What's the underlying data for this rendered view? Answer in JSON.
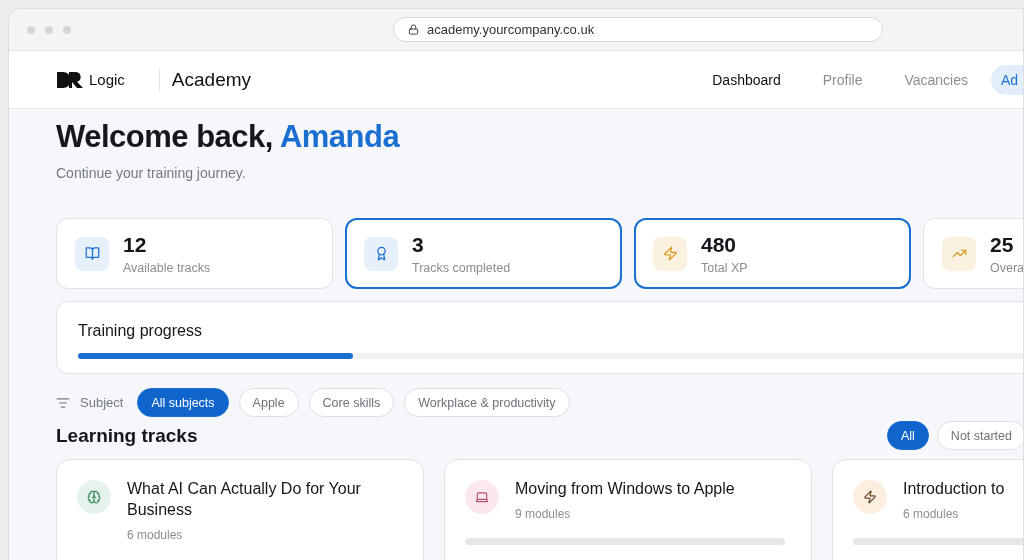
{
  "browser": {
    "url": "academy.yourcompany.co.uk"
  },
  "header": {
    "logo": "Logic",
    "section": "Academy",
    "nav": [
      {
        "label": "Dashboard",
        "kind": "primary"
      },
      {
        "label": "Profile",
        "kind": "muted"
      },
      {
        "label": "Vacancies",
        "kind": "muted"
      },
      {
        "label": "Ad",
        "kind": "pill"
      }
    ]
  },
  "welcome": {
    "greeting": "Welcome back,",
    "name": "Amanda",
    "subtitle": "Continue your training journey."
  },
  "stats": [
    {
      "kind": "book",
      "value": "12",
      "label": "Available tracks",
      "highlighted": false
    },
    {
      "kind": "award",
      "value": "3",
      "label": "Tracks completed",
      "highlighted": true
    },
    {
      "kind": "zap",
      "value": "480",
      "label": "Total XP",
      "highlighted": true
    },
    {
      "kind": "trend",
      "value": "25",
      "label": "Overa",
      "highlighted": false
    }
  ],
  "progress": {
    "title": "Training progress",
    "level": 0.27
  },
  "subject_filter": {
    "label": "Subject",
    "options": [
      {
        "label": "All subjects",
        "selected": true
      },
      {
        "label": "Apple",
        "selected": false
      },
      {
        "label": "Core skills",
        "selected": false
      },
      {
        "label": "Workplace & productivity",
        "selected": false
      }
    ]
  },
  "tracks": {
    "title": "Learning tracks",
    "filters": [
      {
        "label": "All",
        "selected": true
      },
      {
        "label": "Not started",
        "selected": false
      }
    ],
    "items": [
      {
        "kind": "brain",
        "title": "What AI Can Actually Do for Your Business",
        "modules": "6 modules",
        "loading": false
      },
      {
        "kind": "laptop",
        "title": "Moving from Windows to Apple",
        "modules": "9 modules",
        "loading": true
      },
      {
        "kind": "zap",
        "title": "Introduction to",
        "modules": "6 modules",
        "loading": true
      }
    ]
  }
}
